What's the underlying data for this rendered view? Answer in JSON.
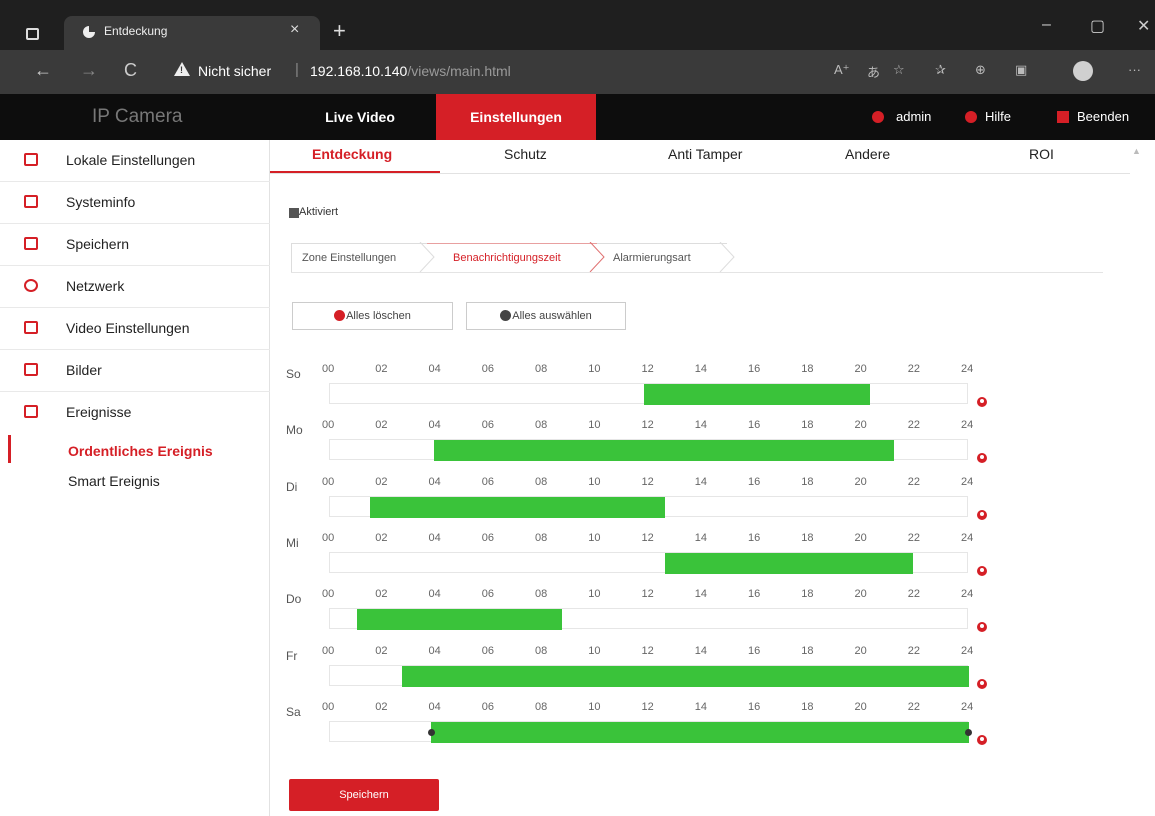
{
  "browser": {
    "tab_title": "Entdeckung",
    "tab_close": "×",
    "new_tab": "+",
    "win_minimize": "–",
    "win_maximize": "▢",
    "win_close": "✕",
    "nav_back": "←",
    "nav_forward": "→",
    "nav_reload": "C",
    "security_text": "Nicht sicher",
    "url_host": "192.168.10.140",
    "url_path": "/views/main.html",
    "separator": "|"
  },
  "app": {
    "brand": "IP Camera",
    "nav": {
      "live": "Live Video",
      "settings": "Einstellungen"
    },
    "header_right": {
      "user": "admin",
      "help": "Hilfe",
      "logout": "Beenden"
    },
    "accent": "#d51f26",
    "bar_color": "#3ac33a"
  },
  "sidebar": {
    "items": [
      {
        "label": "Lokale Einstellungen",
        "icon": "monitor-icon"
      },
      {
        "label": "Systeminfo",
        "icon": "info-card-icon"
      },
      {
        "label": "Speichern",
        "icon": "floppy-icon"
      },
      {
        "label": "Netzwerk",
        "icon": "globe-icon"
      },
      {
        "label": "Video Einstellungen",
        "icon": "video-icon"
      },
      {
        "label": "Bilder",
        "icon": "image-icon"
      },
      {
        "label": "Ereignisse",
        "icon": "list-icon"
      }
    ],
    "sub_items": [
      {
        "label": "Ordentliches Ereignis",
        "active": true
      },
      {
        "label": "Smart Ereignis",
        "active": false
      }
    ]
  },
  "subtabs": [
    "Entdeckung",
    "Schutz",
    "Anti Tamper",
    "Andere",
    "ROI"
  ],
  "enabled_label": "Aktiviert",
  "steps": [
    "Zone Einstellungen",
    "Benachrichtigungszeit",
    "Alarmierungsart"
  ],
  "buttons": {
    "clear_all": "Alles löschen",
    "select_all": "Alles auswählen",
    "save": "Speichern"
  },
  "hours": [
    "00",
    "02",
    "04",
    "06",
    "08",
    "10",
    "12",
    "14",
    "16",
    "18",
    "20",
    "22",
    "24"
  ],
  "schedule": [
    {
      "day": "So",
      "start": 11.8,
      "end": 20.3
    },
    {
      "day": "Mo",
      "start": 3.9,
      "end": 21.2
    },
    {
      "day": "Di",
      "start": 1.5,
      "end": 12.6
    },
    {
      "day": "Mi",
      "start": 12.6,
      "end": 21.9
    },
    {
      "day": "Do",
      "start": 1.0,
      "end": 8.7
    },
    {
      "day": "Fr",
      "start": 2.7,
      "end": 24.0
    },
    {
      "day": "Sa",
      "start": 3.8,
      "end": 24.0,
      "handles": true
    }
  ]
}
